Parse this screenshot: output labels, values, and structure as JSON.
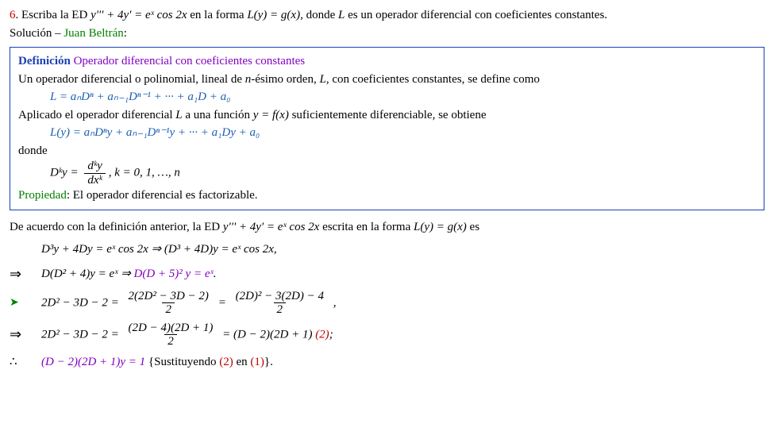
{
  "problem": {
    "num": "6",
    "dot": ". ",
    "pre": "Escriba la ED ",
    "eq": "y''' + 4y' = eˣ cos 2x",
    "mid": " en la forma ",
    "form": "L(y) = g(x)",
    "post": ", donde ",
    "Lword": "L",
    "tail": " es un operador diferencial con coeficientes constantes."
  },
  "sol_label": "Solución – ",
  "sol_author": "Juan Beltrán",
  "sol_colon": ":",
  "def": {
    "head_word": "Definición",
    "head_title": "  Operador diferencial con coeficientes constantes",
    "line1a": "Un operador diferencial o polinomial, lineal de ",
    "line1n": "n",
    "line1b": "-ésimo orden, ",
    "line1L": "L",
    "line1c": ", con coeficientes constantes, se define como",
    "L_expr": "L = aₙDⁿ + aₙ₋₁Dⁿ⁻¹ + ··· + a₁D + a₀",
    "apply_a": "Aplicado el operador diferencial ",
    "apply_L": "L",
    "apply_b": " a una función ",
    "apply_fn": "y = f(x)",
    "apply_c": " suficientemente diferenciable, se obtiene",
    "Ly_expr": "L(y) = aₙDⁿy + aₙ₋₁Dⁿ⁻¹y + ··· + a₁Dy + a₀",
    "donde": "donde",
    "Dk_lhs": "Dᵏy = ",
    "Dk_num": "dᵏy",
    "Dk_den": "dxᵏ",
    "Dk_tail": ",  k = 0, 1, …, n",
    "prop_word": "Propiedad",
    "prop_text": ": El operador diferencial es factorizable."
  },
  "body": {
    "intro_a": "De acuerdo con la definición anterior, la ED ",
    "intro_eq": "y''' + 4y' = eˣ cos 2x",
    "intro_b": " escrita en la forma ",
    "intro_form": "L(y) = g(x)",
    "intro_c": " es",
    "l1": "D³y + 4Dy = eˣ cos 2x  ⇒  (D³ + 4D)y = eˣ cos 2x,",
    "l2a": "D(D² + 4)y = eˣ  ⇒  ",
    "l2b": "D(D + 5)² y = eˣ",
    "l2c": ".",
    "arrow": "➤",
    "imp": "⇒",
    "therefore": "∴",
    "l3_lhs": "2D² − 3D − 2 = ",
    "l3_n1": "2(2D² − 3D − 2)",
    "l3_d1": "2",
    "l3_eq": " = ",
    "l3_n2": "(2D)² − 3(2D) − 4",
    "l3_d2": "2",
    "l3_tail": " ,",
    "l4_lhs": "2D² − 3D − 2 = ",
    "l4_num": "(2D − 4)(2D + 1)",
    "l4_den": "2",
    "l4_rhs": " = (D − 2)(2D + 1)   ",
    "l4_ref": "(2)",
    "l4_semi": ";",
    "l5_eq": "(D − 2)(2D + 1)y = 1",
    "l5_sub": "   {Sustituyendo ",
    "l5_r2": "(2)",
    "l5_in": " en ",
    "l5_r1": "(1)",
    "l5_close": "}."
  }
}
